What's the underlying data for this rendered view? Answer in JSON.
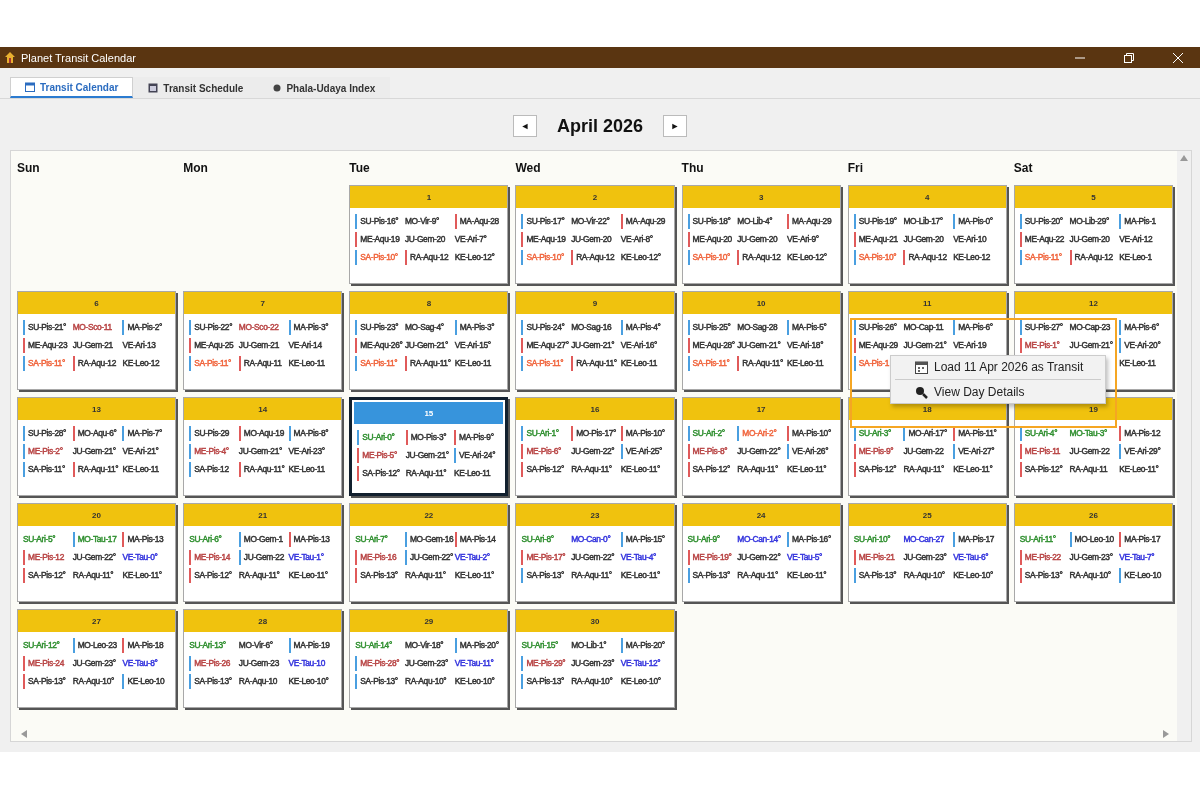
{
  "window": {
    "title": "Planet Transit Calendar"
  },
  "tabs": [
    {
      "label": "Transit Calendar",
      "selected": true,
      "kind": "calendar"
    },
    {
      "label": "Transit Schedule",
      "selected": false,
      "kind": "schedule"
    },
    {
      "label": "Phala-Udaya Index",
      "selected": false,
      "kind": "index"
    }
  ],
  "nav": {
    "prev": "◄",
    "month": "April 2026",
    "next": "►"
  },
  "weekdays": [
    "Sun",
    "Mon",
    "Tue",
    "Wed",
    "Thu",
    "Fri",
    "Sat"
  ],
  "weeks": [
    [
      {
        "kind": "blank"
      },
      {
        "kind": "blank"
      },
      {
        "kind": "day",
        "day": "1",
        "selected": false,
        "rows": [
          [
            {
              "text": "SU-Pis-16°",
              "marker": {
                "color": "#4a9fe0"
              }
            },
            {
              "text": "MO-Vir-9°"
            },
            {
              "text": "MA-Aqu-28",
              "marker": {
                "color": "#e05a5a"
              }
            }
          ],
          [
            {
              "text": "ME-Aqu-19",
              "marker": {
                "color": "#e05a5a"
              }
            },
            {
              "text": "JU-Gem-20"
            },
            {
              "text": "VE-Ari-7°"
            }
          ],
          [
            {
              "text": "SA-Pis-10°",
              "color": "#f0643c",
              "marker": {
                "color": "#4a9fe0"
              }
            },
            {
              "text": "RA-Aqu-12",
              "marker": {
                "color": "#e05a5a"
              }
            },
            {
              "text": "KE-Leo-12°"
            }
          ]
        ]
      },
      {
        "kind": "day",
        "day": "2",
        "selected": false,
        "rows": [
          [
            {
              "text": "SU-Pis-17°",
              "marker": {
                "color": "#4a9fe0"
              }
            },
            {
              "text": "MO-Vir-22°"
            },
            {
              "text": "MA-Aqu-29",
              "marker": {
                "color": "#e05a5a"
              }
            }
          ],
          [
            {
              "text": "ME-Aqu-19",
              "marker": {
                "color": "#e05a5a"
              }
            },
            {
              "text": "JU-Gem-20"
            },
            {
              "text": "VE-Ari-8°"
            }
          ],
          [
            {
              "text": "SA-Pis-10°",
              "color": "#f0643c",
              "marker": {
                "color": "#4a9fe0"
              }
            },
            {
              "text": "RA-Aqu-12",
              "marker": {
                "color": "#e05a5a"
              }
            },
            {
              "text": "KE-Leo-12°"
            }
          ]
        ]
      },
      {
        "kind": "day",
        "day": "3",
        "selected": false,
        "rows": [
          [
            {
              "text": "SU-Pis-18°",
              "marker": {
                "color": "#4a9fe0"
              }
            },
            {
              "text": "MO-Lib-4°"
            },
            {
              "text": "MA-Aqu-29",
              "marker": {
                "color": "#e05a5a"
              }
            }
          ],
          [
            {
              "text": "ME-Aqu-20",
              "marker": {
                "color": "#e05a5a"
              }
            },
            {
              "text": "JU-Gem-20"
            },
            {
              "text": "VE-Ari-9°"
            }
          ],
          [
            {
              "text": "SA-Pis-10°",
              "color": "#f0643c",
              "marker": {
                "color": "#4a9fe0"
              }
            },
            {
              "text": "RA-Aqu-12",
              "marker": {
                "color": "#e05a5a"
              }
            },
            {
              "text": "KE-Leo-12°"
            }
          ]
        ]
      },
      {
        "kind": "day",
        "day": "4",
        "selected": false,
        "rows": [
          [
            {
              "text": "SU-Pis-19°",
              "marker": {
                "color": "#4a9fe0"
              }
            },
            {
              "text": "MO-Lib-17°"
            },
            {
              "text": "MA-Pis-0°",
              "marker": {
                "color": "#4a9fe0"
              }
            }
          ],
          [
            {
              "text": "ME-Aqu-21",
              "marker": {
                "color": "#e05a5a"
              }
            },
            {
              "text": "JU-Gem-20"
            },
            {
              "text": "VE-Ari-10"
            }
          ],
          [
            {
              "text": "SA-Pis-10°",
              "color": "#f0643c",
              "marker": {
                "color": "#4a9fe0"
              }
            },
            {
              "text": "RA-Aqu-12",
              "marker": {
                "color": "#e05a5a"
              }
            },
            {
              "text": "KE-Leo-12"
            }
          ]
        ]
      },
      {
        "kind": "day",
        "day": "5",
        "selected": false,
        "rows": [
          [
            {
              "text": "SU-Pis-20°",
              "marker": {
                "color": "#4a9fe0"
              }
            },
            {
              "text": "MO-Lib-29°"
            },
            {
              "text": "MA-Pis-1",
              "marker": {
                "color": "#4a9fe0"
              }
            }
          ],
          [
            {
              "text": "ME-Aqu-22",
              "marker": {
                "color": "#e05a5a"
              }
            },
            {
              "text": "JU-Gem-20"
            },
            {
              "text": "VE-Ari-12"
            }
          ],
          [
            {
              "text": "SA-Pis-11°",
              "color": "#f0643c",
              "marker": {
                "color": "#4a9fe0"
              }
            },
            {
              "text": "RA-Aqu-12",
              "marker": {
                "color": "#e05a5a"
              }
            },
            {
              "text": "KE-Leo-1"
            }
          ]
        ]
      }
    ],
    [
      {
        "kind": "day",
        "day": "6",
        "selected": false,
        "rows": [
          [
            {
              "text": "SU-Pis-21°",
              "marker": {
                "color": "#4a9fe0"
              }
            },
            {
              "text": "MO-Sco-11",
              "color": "#b84444"
            },
            {
              "text": "MA-Pis-2°",
              "marker": {
                "color": "#4a9fe0"
              }
            }
          ],
          [
            {
              "text": "ME-Aqu-23",
              "marker": {
                "color": "#e05a5a"
              }
            },
            {
              "text": "JU-Gem-21"
            },
            {
              "text": "VE-Ari-13"
            }
          ],
          [
            {
              "text": "SA-Pis-11°",
              "color": "#f0643c",
              "marker": {
                "color": "#4a9fe0"
              }
            },
            {
              "text": "RA-Aqu-12",
              "marker": {
                "color": "#e05a5a"
              }
            },
            {
              "text": "KE-Leo-12"
            }
          ]
        ]
      },
      {
        "kind": "day",
        "day": "7",
        "selected": false,
        "rows": [
          [
            {
              "text": "SU-Pis-22°",
              "marker": {
                "color": "#4a9fe0"
              }
            },
            {
              "text": "MO-Sco-22",
              "color": "#b84444"
            },
            {
              "text": "MA-Pis-3°",
              "marker": {
                "color": "#4a9fe0"
              }
            }
          ],
          [
            {
              "text": "ME-Aqu-25",
              "marker": {
                "color": "#e05a5a"
              }
            },
            {
              "text": "JU-Gem-21"
            },
            {
              "text": "VE-Ari-14"
            }
          ],
          [
            {
              "text": "SA-Pis-11°",
              "color": "#f0643c",
              "marker": {
                "color": "#4a9fe0"
              }
            },
            {
              "text": "RA-Aqu-11",
              "marker": {
                "color": "#e05a5a"
              }
            },
            {
              "text": "KE-Leo-11"
            }
          ]
        ]
      },
      {
        "kind": "day",
        "day": "8",
        "selected": false,
        "rows": [
          [
            {
              "text": "SU-Pis-23°",
              "marker": {
                "color": "#4a9fe0"
              }
            },
            {
              "text": "MO-Sag-4°"
            },
            {
              "text": "MA-Pis-3°",
              "marker": {
                "color": "#4a9fe0"
              }
            }
          ],
          [
            {
              "text": "ME-Aqu-26°",
              "marker": {
                "color": "#e05a5a"
              }
            },
            {
              "text": "JU-Gem-21°"
            },
            {
              "text": "VE-Ari-15°"
            }
          ],
          [
            {
              "text": "SA-Pis-11°",
              "color": "#f0643c",
              "marker": {
                "color": "#4a9fe0"
              }
            },
            {
              "text": "RA-Aqu-11°",
              "marker": {
                "color": "#e05a5a"
              }
            },
            {
              "text": "KE-Leo-11"
            }
          ]
        ]
      },
      {
        "kind": "day",
        "day": "9",
        "selected": false,
        "rows": [
          [
            {
              "text": "SU-Pis-24°",
              "marker": {
                "color": "#4a9fe0"
              }
            },
            {
              "text": "MO-Sag-16"
            },
            {
              "text": "MA-Pis-4°",
              "marker": {
                "color": "#4a9fe0"
              }
            }
          ],
          [
            {
              "text": "ME-Aqu-27°",
              "marker": {
                "color": "#e05a5a"
              }
            },
            {
              "text": "JU-Gem-21°"
            },
            {
              "text": "VE-Ari-16°"
            }
          ],
          [
            {
              "text": "SA-Pis-11°",
              "color": "#f0643c",
              "marker": {
                "color": "#4a9fe0"
              }
            },
            {
              "text": "RA-Aqu-11°",
              "marker": {
                "color": "#e05a5a"
              }
            },
            {
              "text": "KE-Leo-11"
            }
          ]
        ]
      },
      {
        "kind": "day",
        "day": "10",
        "selected": false,
        "rows": [
          [
            {
              "text": "SU-Pis-25°",
              "marker": {
                "color": "#4a9fe0"
              }
            },
            {
              "text": "MO-Sag-28"
            },
            {
              "text": "MA-Pis-5°",
              "marker": {
                "color": "#4a9fe0"
              }
            }
          ],
          [
            {
              "text": "ME-Aqu-28°",
              "marker": {
                "color": "#e05a5a"
              }
            },
            {
              "text": "JU-Gem-21°"
            },
            {
              "text": "VE-Ari-18°"
            }
          ],
          [
            {
              "text": "SA-Pis-11°",
              "color": "#f0643c",
              "marker": {
                "color": "#4a9fe0"
              }
            },
            {
              "text": "RA-Aqu-11°",
              "marker": {
                "color": "#e05a5a"
              }
            },
            {
              "text": "KE-Leo-11"
            }
          ]
        ]
      },
      {
        "kind": "day",
        "day": "11",
        "selected": false,
        "rows": [
          [
            {
              "text": "SU-Pis-26°",
              "marker": {
                "color": "#4a9fe0"
              }
            },
            {
              "text": "MO-Cap-11"
            },
            {
              "text": "MA-Pis-6°",
              "marker": {
                "color": "#4a9fe0"
              }
            }
          ],
          [
            {
              "text": "ME-Aqu-29",
              "marker": {
                "color": "#e05a5a"
              }
            },
            {
              "text": "JU-Gem-21°"
            },
            {
              "text": "VE-Ari-19"
            }
          ],
          [
            {
              "text": "SA-Pis-1",
              "color": "#f0643c",
              "marker": {
                "color": "#4a9fe0"
              }
            }
          ]
        ]
      },
      {
        "kind": "day",
        "day": "12",
        "selected": false,
        "rows": [
          [
            {
              "text": "SU-Pis-27°",
              "marker": {
                "color": "#4a9fe0"
              }
            },
            {
              "text": "MO-Cap-23"
            },
            {
              "text": "MA-Pis-6°",
              "marker": {
                "color": "#4a9fe0"
              }
            }
          ],
          [
            {
              "text": "ME-Pis-1°",
              "color": "#b84444",
              "marker": {
                "color": "#e05a5a"
              }
            },
            {
              "text": "JU-Gem-21°"
            },
            {
              "text": "VE-Ari-20°",
              "marker": {
                "color": "#4a9fe0"
              }
            }
          ],
          [
            {
              "kind": "covered"
            },
            {
              "kind": "covered"
            },
            {
              "text": "KE-Leo-11"
            }
          ]
        ]
      }
    ],
    [
      {
        "kind": "day",
        "day": "13",
        "selected": false,
        "rows": [
          [
            {
              "text": "SU-Pis-28°",
              "marker": {
                "color": "#4a9fe0"
              }
            },
            {
              "text": "MO-Aqu-6°",
              "marker": {
                "color": "#e05a5a"
              }
            },
            {
              "text": "MA-Pis-7°",
              "marker": {
                "color": "#4a9fe0"
              }
            }
          ],
          [
            {
              "text": "ME-Pis-2°",
              "color": "#b84444",
              "marker": {
                "color": "#4a9fe0"
              }
            },
            {
              "text": "JU-Gem-21°"
            },
            {
              "text": "VE-Ari-21°"
            }
          ],
          [
            {
              "text": "SA-Pis-11°",
              "marker": {
                "color": "#4a9fe0"
              }
            },
            {
              "text": "RA-Aqu-11°",
              "marker": {
                "color": "#e05a5a"
              }
            },
            {
              "text": "KE-Leo-11"
            }
          ]
        ]
      },
      {
        "kind": "day",
        "day": "14",
        "selected": false,
        "rows": [
          [
            {
              "text": "SU-Pis-29",
              "marker": {
                "color": "#4a9fe0"
              }
            },
            {
              "text": "MO-Aqu-19",
              "marker": {
                "color": "#e05a5a"
              }
            },
            {
              "text": "MA-Pis-8°",
              "marker": {
                "color": "#4a9fe0"
              }
            }
          ],
          [
            {
              "text": "ME-Pis-4°",
              "color": "#b84444",
              "marker": {
                "color": "#4a9fe0"
              }
            },
            {
              "text": "JU-Gem-21°"
            },
            {
              "text": "VE-Ari-23°"
            }
          ],
          [
            {
              "text": "SA-Pis-12",
              "marker": {
                "color": "#4a9fe0"
              }
            },
            {
              "text": "RA-Aqu-11°",
              "marker": {
                "color": "#e05a5a"
              }
            },
            {
              "text": "KE-Leo-11"
            }
          ]
        ]
      },
      {
        "kind": "day",
        "day": "15",
        "selected": true,
        "rows": [
          [
            {
              "text": "SU-Ari-0°",
              "color": "#2f8f2f",
              "marker": {
                "color": "#4a9fe0"
              }
            },
            {
              "text": "MO-Pis-3°",
              "marker": {
                "color": "#e05a5a"
              }
            },
            {
              "text": "MA-Pis-9°",
              "marker": {
                "color": "#e05a5a"
              }
            }
          ],
          [
            {
              "text": "ME-Pis-5°",
              "color": "#b84444",
              "marker": {
                "color": "#e05a5a"
              }
            },
            {
              "text": "JU-Gem-21°"
            },
            {
              "text": "VE-Ari-24°",
              "marker": {
                "color": "#4a9fe0"
              }
            }
          ],
          [
            {
              "text": "SA-Pis-12°",
              "marker": {
                "color": "#e05a5a"
              }
            },
            {
              "text": "RA-Aqu-11°"
            },
            {
              "text": "KE-Leo-11"
            }
          ]
        ]
      },
      {
        "kind": "day",
        "day": "16",
        "selected": false,
        "rows": [
          [
            {
              "text": "SU-Ari-1°",
              "color": "#2f8f2f",
              "marker": {
                "color": "#4a9fe0"
              }
            },
            {
              "text": "MO-Pis-17°",
              "marker": {
                "color": "#e05a5a"
              }
            },
            {
              "text": "MA-Pis-10°",
              "marker": {
                "color": "#e05a5a"
              }
            }
          ],
          [
            {
              "text": "ME-Pis-6°",
              "color": "#b84444",
              "marker": {
                "color": "#e05a5a"
              }
            },
            {
              "text": "JU-Gem-22°"
            },
            {
              "text": "VE-Ari-25°",
              "marker": {
                "color": "#4a9fe0"
              }
            }
          ],
          [
            {
              "text": "SA-Pis-12°",
              "marker": {
                "color": "#e05a5a"
              }
            },
            {
              "text": "RA-Aqu-11°"
            },
            {
              "text": "KE-Leo-11°"
            }
          ]
        ]
      },
      {
        "kind": "day",
        "day": "17",
        "selected": false,
        "rows": [
          [
            {
              "text": "SU-Ari-2°",
              "color": "#2f8f2f",
              "marker": {
                "color": "#4a9fe0"
              }
            },
            {
              "text": "MO-Ari-2°",
              "color": "#f0643c",
              "marker": {
                "color": "#4a9fe0"
              }
            },
            {
              "text": "MA-Pis-10°",
              "marker": {
                "color": "#e05a5a"
              }
            }
          ],
          [
            {
              "text": "ME-Pis-8°",
              "color": "#b84444",
              "marker": {
                "color": "#e05a5a"
              }
            },
            {
              "text": "JU-Gem-22°"
            },
            {
              "text": "VE-Ari-26°",
              "marker": {
                "color": "#4a9fe0"
              }
            }
          ],
          [
            {
              "text": "SA-Pis-12°",
              "marker": {
                "color": "#e05a5a"
              }
            },
            {
              "text": "RA-Aqu-11°"
            },
            {
              "text": "KE-Leo-11°"
            }
          ]
        ]
      },
      {
        "kind": "day",
        "day": "18",
        "selected": false,
        "rows": [
          [
            {
              "text": "SU-Ari-3°",
              "color": "#2f8f2f",
              "marker": {
                "color": "#4a9fe0"
              }
            },
            {
              "text": "MO-Ari-17°",
              "marker": {
                "color": "#4a9fe0"
              }
            },
            {
              "text": "MA-Pis-11°",
              "marker": {
                "color": "#e05a5a"
              }
            }
          ],
          [
            {
              "text": "ME-Pis-9°",
              "color": "#b84444",
              "marker": {
                "color": "#e05a5a"
              }
            },
            {
              "text": "JU-Gem-22"
            },
            {
              "text": "VE-Ari-27°",
              "marker": {
                "color": "#4a9fe0"
              }
            }
          ],
          [
            {
              "text": "SA-Pis-12°",
              "marker": {
                "color": "#e05a5a"
              }
            },
            {
              "text": "RA-Aqu-11°"
            },
            {
              "text": "KE-Leo-11°"
            }
          ]
        ]
      },
      {
        "kind": "day",
        "day": "19",
        "selected": false,
        "rows": [
          [
            {
              "text": "SU-Ari-4°",
              "color": "#2f8f2f",
              "marker": {
                "color": "#4a9fe0"
              }
            },
            {
              "text": "MO-Tau-3°",
              "color": "#2f8f2f"
            },
            {
              "text": "MA-Pis-12",
              "marker": {
                "color": "#e05a5a"
              }
            }
          ],
          [
            {
              "text": "ME-Pis-11",
              "color": "#b84444",
              "marker": {
                "color": "#e05a5a"
              }
            },
            {
              "text": "JU-Gem-22"
            },
            {
              "text": "VE-Ari-29°",
              "marker": {
                "color": "#4a9fe0"
              }
            }
          ],
          [
            {
              "text": "SA-Pis-12°",
              "marker": {
                "color": "#e05a5a"
              }
            },
            {
              "text": "RA-Aqu-11"
            },
            {
              "text": "KE-Leo-11°"
            }
          ]
        ]
      }
    ],
    [
      {
        "kind": "day",
        "day": "20",
        "selected": false,
        "rows": [
          [
            {
              "text": "SU-Ari-5°",
              "color": "#2f8f2f"
            },
            {
              "text": "MO-Tau-17",
              "color": "#2f8f2f",
              "marker": {
                "color": "#4a9fe0"
              }
            },
            {
              "text": "MA-Pis-13",
              "marker": {
                "color": "#e05a5a"
              }
            }
          ],
          [
            {
              "text": "ME-Pis-12",
              "color": "#b84444",
              "marker": {
                "color": "#e05a5a"
              }
            },
            {
              "text": "JU-Gem-22°"
            },
            {
              "text": "VE-Tau-0°",
              "color": "#3333dd"
            }
          ],
          [
            {
              "text": "SA-Pis-12°",
              "marker": {
                "color": "#e05a5a"
              }
            },
            {
              "text": "RA-Aqu-11°"
            },
            {
              "text": "KE-Leo-11°"
            }
          ]
        ]
      },
      {
        "kind": "day",
        "day": "21",
        "selected": false,
        "rows": [
          [
            {
              "text": "SU-Ari-6°",
              "color": "#2f8f2f"
            },
            {
              "text": "MO-Gem-1",
              "marker": {
                "color": "#4a9fe0"
              }
            },
            {
              "text": "MA-Pis-13",
              "marker": {
                "color": "#e05a5a"
              }
            }
          ],
          [
            {
              "text": "ME-Pis-14",
              "color": "#b84444",
              "marker": {
                "color": "#e05a5a"
              }
            },
            {
              "text": "JU-Gem-22",
              "marker": {
                "color": "#4a9fe0"
              }
            },
            {
              "text": "VE-Tau-1°",
              "color": "#3333dd"
            }
          ],
          [
            {
              "text": "SA-Pis-12°",
              "marker": {
                "color": "#e05a5a"
              }
            },
            {
              "text": "RA-Aqu-11°"
            },
            {
              "text": "KE-Leo-11°"
            }
          ]
        ]
      },
      {
        "kind": "day",
        "day": "22",
        "selected": false,
        "rows": [
          [
            {
              "text": "SU-Ari-7°",
              "color": "#2f8f2f"
            },
            {
              "text": "MO-Gem-16",
              "marker": {
                "color": "#4a9fe0"
              }
            },
            {
              "text": "MA-Pis-14",
              "marker": {
                "color": "#e05a5a"
              }
            }
          ],
          [
            {
              "text": "ME-Pis-16",
              "color": "#b84444",
              "marker": {
                "color": "#e05a5a"
              }
            },
            {
              "text": "JU-Gem-22°",
              "marker": {
                "color": "#4a9fe0"
              }
            },
            {
              "text": "VE-Tau-2°",
              "color": "#3333dd"
            }
          ],
          [
            {
              "text": "SA-Pis-13°",
              "marker": {
                "color": "#e05a5a"
              }
            },
            {
              "text": "RA-Aqu-11°"
            },
            {
              "text": "KE-Leo-11°"
            }
          ]
        ]
      },
      {
        "kind": "day",
        "day": "23",
        "selected": false,
        "rows": [
          [
            {
              "text": "SU-Ari-8°",
              "color": "#2f8f2f"
            },
            {
              "text": "MO-Can-0°",
              "color": "#3333dd"
            },
            {
              "text": "MA-Pis-15°",
              "marker": {
                "color": "#4a9fe0"
              }
            }
          ],
          [
            {
              "text": "ME-Pis-17°",
              "color": "#b84444",
              "marker": {
                "color": "#e05a5a"
              }
            },
            {
              "text": "JU-Gem-22°"
            },
            {
              "text": "VE-Tau-4°",
              "color": "#3333dd"
            }
          ],
          [
            {
              "text": "SA-Pis-13°",
              "marker": {
                "color": "#4a9fe0"
              }
            },
            {
              "text": "RA-Aqu-11°"
            },
            {
              "text": "KE-Leo-11°"
            }
          ]
        ]
      },
      {
        "kind": "day",
        "day": "24",
        "selected": false,
        "rows": [
          [
            {
              "text": "SU-Ari-9°",
              "color": "#2f8f2f"
            },
            {
              "text": "MO-Can-14°",
              "color": "#3333dd"
            },
            {
              "text": "MA-Pis-16°",
              "marker": {
                "color": "#4a9fe0"
              }
            }
          ],
          [
            {
              "text": "ME-Pis-19°",
              "color": "#b84444",
              "marker": {
                "color": "#e05a5a"
              }
            },
            {
              "text": "JU-Gem-22°"
            },
            {
              "text": "VE-Tau-5°",
              "color": "#3333dd"
            }
          ],
          [
            {
              "text": "SA-Pis-13°",
              "marker": {
                "color": "#4a9fe0"
              }
            },
            {
              "text": "RA-Aqu-11°"
            },
            {
              "text": "KE-Leo-11°"
            }
          ]
        ]
      },
      {
        "kind": "day",
        "day": "25",
        "selected": false,
        "rows": [
          [
            {
              "text": "SU-Ari-10°",
              "color": "#2f8f2f"
            },
            {
              "text": "MO-Can-27",
              "color": "#3333dd"
            },
            {
              "text": "MA-Pis-17",
              "marker": {
                "color": "#4a9fe0"
              }
            }
          ],
          [
            {
              "text": "ME-Pis-21",
              "color": "#b84444",
              "marker": {
                "color": "#e05a5a"
              }
            },
            {
              "text": "JU-Gem-23°"
            },
            {
              "text": "VE-Tau-6°",
              "color": "#3333dd"
            }
          ],
          [
            {
              "text": "SA-Pis-13°",
              "marker": {
                "color": "#4a9fe0"
              }
            },
            {
              "text": "RA-Aqu-10°"
            },
            {
              "text": "KE-Leo-10°"
            }
          ]
        ]
      },
      {
        "kind": "day",
        "day": "26",
        "selected": false,
        "rows": [
          [
            {
              "text": "SU-Ari-11°",
              "color": "#2f8f2f"
            },
            {
              "text": "MO-Leo-10",
              "marker": {
                "color": "#4a9fe0"
              }
            },
            {
              "text": "MA-Pis-17",
              "marker": {
                "color": "#e05a5a"
              }
            }
          ],
          [
            {
              "text": "ME-Pis-22",
              "color": "#b84444",
              "marker": {
                "color": "#e05a5a"
              }
            },
            {
              "text": "JU-Gem-23°"
            },
            {
              "text": "VE-Tau-7°",
              "color": "#3333dd"
            }
          ],
          [
            {
              "text": "SA-Pis-13°",
              "marker": {
                "color": "#e05a5a"
              }
            },
            {
              "text": "RA-Aqu-10°"
            },
            {
              "text": "KE-Leo-10",
              "marker": {
                "color": "#4a9fe0"
              }
            }
          ]
        ]
      }
    ],
    [
      {
        "kind": "day",
        "day": "27",
        "selected": false,
        "rows": [
          [
            {
              "text": "SU-Ari-12°",
              "color": "#2f8f2f"
            },
            {
              "text": "MO-Leo-23",
              "marker": {
                "color": "#4a9fe0"
              }
            },
            {
              "text": "MA-Pis-18",
              "marker": {
                "color": "#e05a5a"
              }
            }
          ],
          [
            {
              "text": "ME-Pis-24",
              "color": "#b84444",
              "marker": {
                "color": "#e05a5a"
              }
            },
            {
              "text": "JU-Gem-23°"
            },
            {
              "text": "VE-Tau-8°",
              "color": "#3333dd"
            }
          ],
          [
            {
              "text": "SA-Pis-13°",
              "marker": {
                "color": "#e05a5a"
              }
            },
            {
              "text": "RA-Aqu-10°"
            },
            {
              "text": "KE-Leo-10",
              "marker": {
                "color": "#4a9fe0"
              }
            }
          ]
        ]
      },
      {
        "kind": "day",
        "day": "28",
        "selected": false,
        "rows": [
          [
            {
              "text": "SU-Ari-13°",
              "color": "#2f8f2f"
            },
            {
              "text": "MO-Vir-6°"
            },
            {
              "text": "MA-Pis-19",
              "marker": {
                "color": "#4a9fe0"
              }
            }
          ],
          [
            {
              "text": "ME-Pis-26",
              "color": "#b84444",
              "marker": {
                "color": "#4a9fe0"
              }
            },
            {
              "text": "JU-Gem-23"
            },
            {
              "text": "VE-Tau-10",
              "color": "#3333dd"
            }
          ],
          [
            {
              "text": "SA-Pis-13°",
              "marker": {
                "color": "#4a9fe0"
              }
            },
            {
              "text": "RA-Aqu-10"
            },
            {
              "text": "KE-Leo-10°"
            }
          ]
        ]
      },
      {
        "kind": "day",
        "day": "29",
        "selected": false,
        "rows": [
          [
            {
              "text": "SU-Ari-14°",
              "color": "#2f8f2f"
            },
            {
              "text": "MO-Vir-18°"
            },
            {
              "text": "MA-Pis-20°",
              "marker": {
                "color": "#4a9fe0"
              }
            }
          ],
          [
            {
              "text": "ME-Pis-28°",
              "color": "#b84444",
              "marker": {
                "color": "#4a9fe0"
              }
            },
            {
              "text": "JU-Gem-23°"
            },
            {
              "text": "VE-Tau-11°",
              "color": "#3333dd"
            }
          ],
          [
            {
              "text": "SA-Pis-13°",
              "marker": {
                "color": "#4a9fe0"
              }
            },
            {
              "text": "RA-Aqu-10°"
            },
            {
              "text": "KE-Leo-10°"
            }
          ]
        ]
      },
      {
        "kind": "day",
        "day": "30",
        "selected": false,
        "rows": [
          [
            {
              "text": "SU-Ari-15°",
              "color": "#2f8f2f"
            },
            {
              "text": "MO-Lib-1°"
            },
            {
              "text": "MA-Pis-20°",
              "marker": {
                "color": "#4a9fe0"
              }
            }
          ],
          [
            {
              "text": "ME-Pis-29°",
              "color": "#b84444",
              "marker": {
                "color": "#4a9fe0"
              }
            },
            {
              "text": "JU-Gem-23°"
            },
            {
              "text": "VE-Tau-12°",
              "color": "#3333dd"
            }
          ],
          [
            {
              "text": "SA-Pis-13°",
              "marker": {
                "color": "#4a9fe0"
              }
            },
            {
              "text": "RA-Aqu-10°"
            },
            {
              "text": "KE-Leo-10°"
            }
          ]
        ]
      }
    ]
  ],
  "context_menu": {
    "items": [
      {
        "label": "Load 11 Apr 2026 as Transit",
        "kind": "calendar"
      },
      {
        "label": "View Day Details",
        "kind": "search"
      }
    ]
  }
}
